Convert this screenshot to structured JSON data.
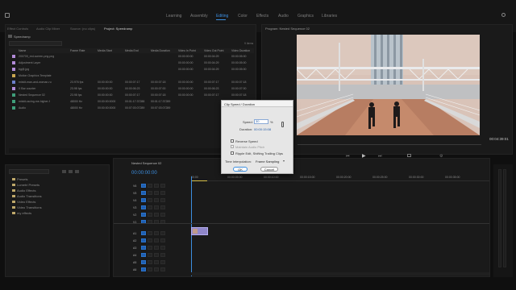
{
  "workspaces": {
    "items": [
      "Learning",
      "Assembly",
      "Editing",
      "Color",
      "Effects",
      "Audio",
      "Graphics",
      "Libraries"
    ],
    "active": "Editing"
  },
  "project_panel": {
    "tabs": [
      "Effect Controls",
      "Audio Clip Mixer",
      "Source: (no clips)",
      "Project: Speedramp"
    ],
    "project_name": "Speedramp",
    "item_count": "9 items",
    "columns": [
      "Name",
      "Frame Rate",
      "Media Start",
      "Media End",
      "Media Duration",
      "Video In Point",
      "Video Out Point",
      "Video Duration"
    ],
    "rows": [
      {
        "name": "200709_red-screen-png.png",
        "frame_rate": "",
        "media_start": "",
        "media_end": "",
        "media_duration": "",
        "vin": "00:00:00:00",
        "vout": "00:00:04:29",
        "vdur": "00:00:05:00",
        "color": "#b28bd8"
      },
      {
        "name": "Adjustment Layer",
        "frame_rate": "",
        "media_start": "",
        "media_end": "",
        "media_duration": "",
        "vin": "00:00:00:00",
        "vout": "00:00:04:29",
        "vdur": "00:00:05:00",
        "color": "#b28bd8"
      },
      {
        "name": "bg@.jpg",
        "frame_rate": "",
        "media_start": "",
        "media_end": "",
        "media_duration": "",
        "vin": "00:00:00:00",
        "vout": "00:00:04:29",
        "vdur": "00:00:05:00",
        "color": "#b28bd8"
      },
      {
        "name": "Motion Graphics Template",
        "frame_rate": "",
        "media_start": "",
        "media_end": "",
        "media_duration": "",
        "vin": "",
        "vout": "",
        "vdur": "",
        "color": "#c9a64f"
      },
      {
        "name": "mixkit-man-and-woman-ru",
        "frame_rate": "23.976 fps",
        "media_start": "00:00:00:00",
        "media_end": "00:00:07:17",
        "media_duration": "00:00:07:18",
        "vin": "00:00:00:00",
        "vout": "00:00:07:17",
        "vdur": "00:00:07:18",
        "color": "#6c7fc9"
      },
      {
        "name": "X Bar counter",
        "frame_rate": "23.98 fps",
        "media_start": "00:00:00:00",
        "media_end": "00:00:06:23",
        "media_duration": "00:00:07:00",
        "vin": "00:00:00:00",
        "vout": "00:00:06:23",
        "vdur": "00:00:07:00",
        "color": "#b28bd8"
      },
      {
        "name": "Nested Sequence 02",
        "frame_rate": "23.98 fps",
        "media_start": "00:00:00:00",
        "media_end": "00:00:07:17",
        "media_duration": "00:00:07:18",
        "vin": "00:00:00:00",
        "vout": "00:00:07:17",
        "vdur": "00:00:07:18",
        "color": "#3f9e7a"
      },
      {
        "name": "mixkit-racing-me-higher-f",
        "frame_rate": "48000 Hz",
        "media_start": "00:00:00:0000",
        "media_end": "00:01:17:37288",
        "media_duration": "00:01:17:37289",
        "vin": "",
        "vout": "",
        "vdur": "",
        "color": "#3f9e7a"
      },
      {
        "name": "Audio",
        "frame_rate": "48000 Hz",
        "media_start": "00:00:00:0000",
        "media_end": "00:07:03:07289",
        "media_duration": "00:07:03:07289",
        "vin": "",
        "vout": "",
        "vdur": "",
        "color": "#3f9e7a"
      }
    ]
  },
  "program_panel": {
    "title": "Program: Nested Sequence 02",
    "timecode": "00:04:39:01"
  },
  "dialog": {
    "title": "Clip Speed / Duration",
    "speed_label": "Speed:",
    "speed_value": "30",
    "speed_unit": "%",
    "duration_label": "Duration:",
    "duration_value": "00:00:15:08",
    "reverse_label": "Reverse Speed",
    "maintain_label": "Maintain Audio Pitch",
    "ripple_label": "Ripple Edit, Shifting Trailing Clips",
    "interp_label": "Time Interpolation:",
    "interp_value": "Frame Sampling",
    "ok": "OK",
    "cancel": "Cancel"
  },
  "effects_panel": {
    "items": [
      "Presets",
      "Lumetri Presets",
      "Audio Effects",
      "Audio Transitions",
      "Video Effects",
      "Video Transitions",
      "my effects"
    ]
  },
  "timeline": {
    "tab": "Nested Sequence 02",
    "timecode": "00:00:00:00",
    "ruler": [
      "00:00",
      "00:00:05:00",
      "00:00:10:00",
      "00:00:15:00",
      "00:00:20:00",
      "00:00:25:00",
      "00:00:30:00",
      "00:00:35:00"
    ],
    "video_tracks": [
      "V6",
      "V5",
      "V4",
      "V3",
      "V2",
      "V1"
    ],
    "audio_tracks": [
      "A1",
      "A2",
      "A3",
      "A4",
      "A5",
      "A6"
    ]
  },
  "colors": {
    "accent": "#3d8fe0",
    "clip": "#8f86c9",
    "track_blue": "#1f5fb2"
  }
}
